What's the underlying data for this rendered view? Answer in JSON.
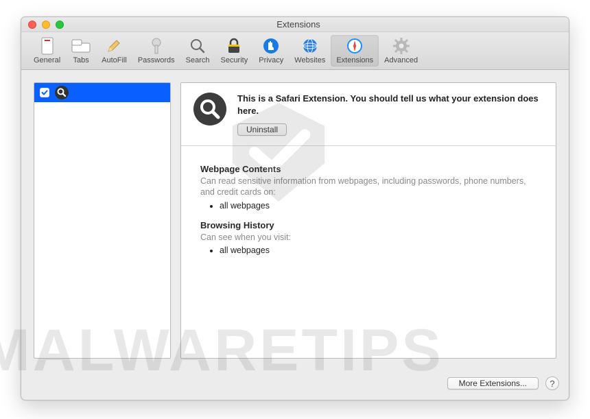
{
  "watermark_text": "MALWARETIPS",
  "window": {
    "title": "Extensions"
  },
  "toolbar": {
    "items": [
      {
        "label": "General"
      },
      {
        "label": "Tabs"
      },
      {
        "label": "AutoFill"
      },
      {
        "label": "Passwords"
      },
      {
        "label": "Search"
      },
      {
        "label": "Security"
      },
      {
        "label": "Privacy"
      },
      {
        "label": "Websites"
      },
      {
        "label": "Extensions"
      },
      {
        "label": "Advanced"
      }
    ],
    "selected_index": 8
  },
  "sidebar": {
    "items": [
      {
        "checked": true,
        "label": ""
      }
    ]
  },
  "detail": {
    "heading": "This is a Safari Extension. You should tell us what your extension does here.",
    "uninstall_label": "Uninstall",
    "permissions": [
      {
        "title": "Webpage Contents",
        "subtitle": "Can read sensitive information from webpages, including passwords, phone numbers, and credit cards on:",
        "bullets": [
          "all webpages"
        ]
      },
      {
        "title": "Browsing History",
        "subtitle": "Can see when you visit:",
        "bullets": [
          "all webpages"
        ]
      }
    ]
  },
  "footer": {
    "more_label": "More Extensions...",
    "help_label": "?"
  }
}
